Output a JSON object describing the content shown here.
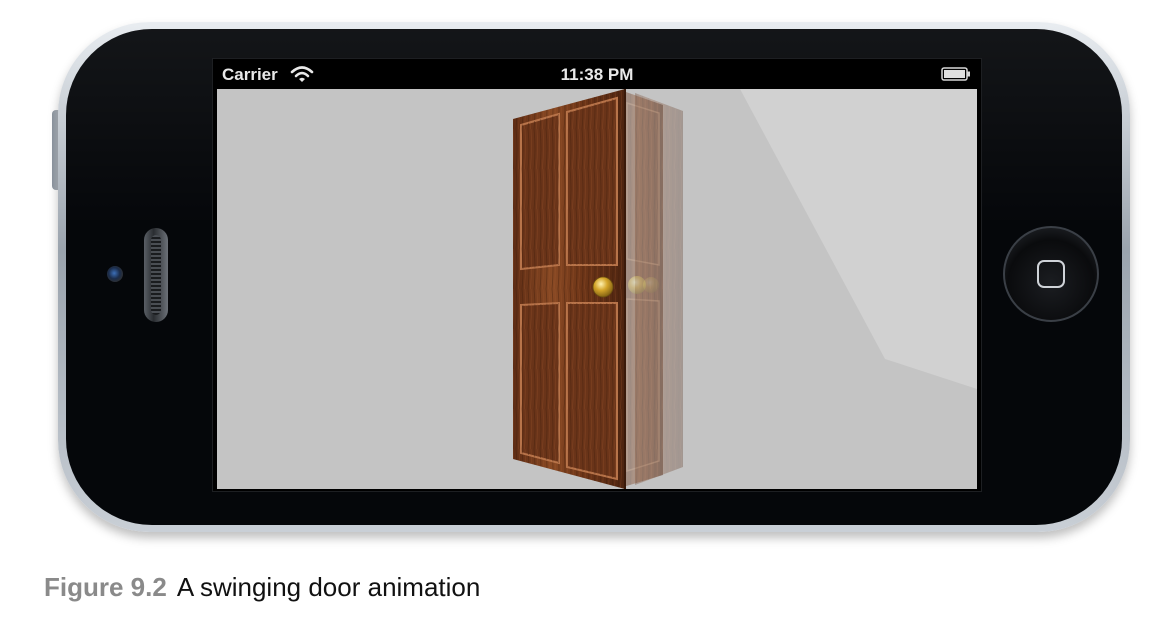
{
  "status_bar": {
    "carrier": "Carrier",
    "time": "11:38 PM",
    "wifi_icon": "wifi-icon",
    "battery_icon": "battery-icon"
  },
  "scene": {
    "subject": "door",
    "door_color": "#7a3f22",
    "knob_color": "#d4a52a",
    "background_color": "#c4c4c4"
  },
  "device": {
    "home_button_icon": "home-square-icon",
    "camera_icon": "camera-icon",
    "speaker_icon": "speaker-icon"
  },
  "caption": {
    "figure_number": "Figure 9.2",
    "text": "A swinging door animation"
  }
}
